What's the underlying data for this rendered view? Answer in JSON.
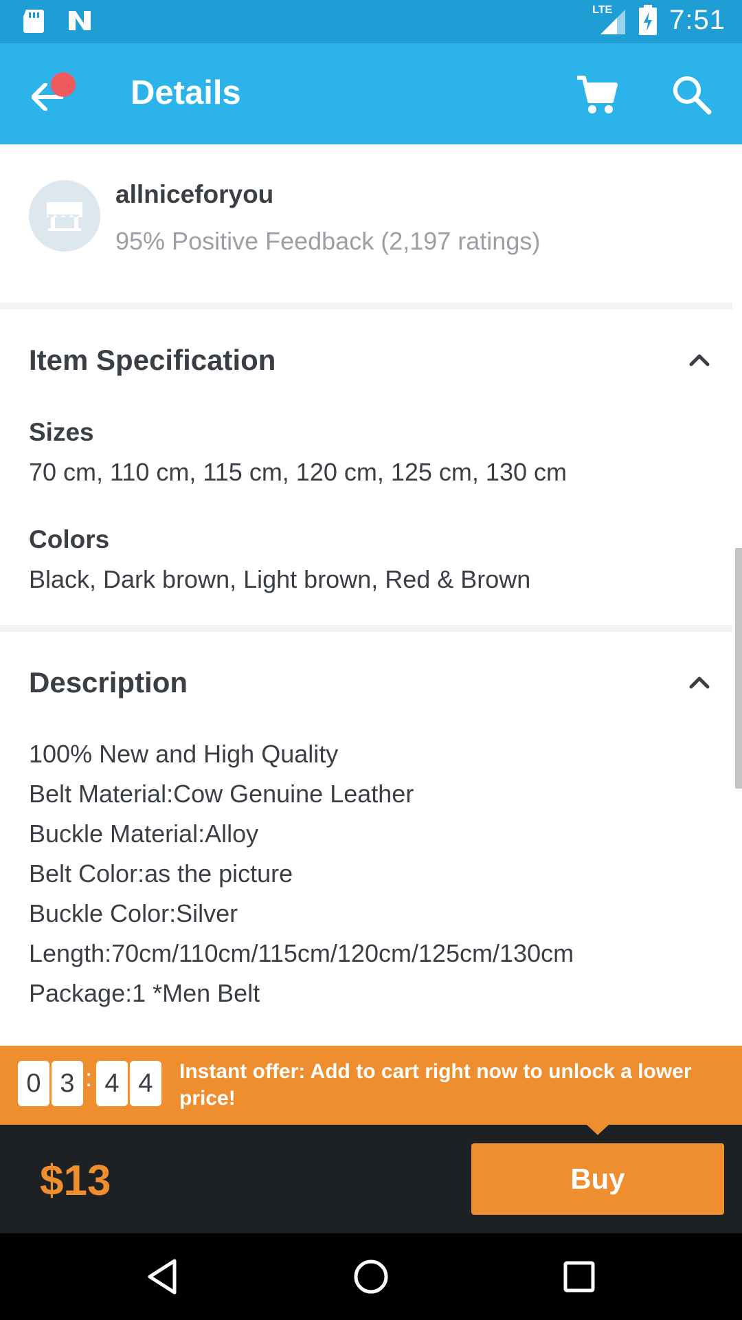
{
  "status_bar": {
    "network": "LTE",
    "time": "7:51",
    "icons": [
      "sd-card-icon",
      "n-app-icon",
      "lte-signal-icon",
      "battery-charging-icon"
    ]
  },
  "app_bar": {
    "title": "Details",
    "icons": [
      "back-arrow-icon",
      "cart-icon",
      "search-icon"
    ],
    "notification_dot_color": "#ee5a5e"
  },
  "seller": {
    "name": "allniceforyou",
    "feedback": "95% Positive Feedback (2,197 ratings)",
    "avatar_icon": "store-icon"
  },
  "item_specification": {
    "title": "Item Specification",
    "attributes": [
      {
        "label": "Sizes",
        "value": "70 cm, 110 cm, 115 cm, 120 cm, 125 cm, 130 cm"
      },
      {
        "label": "Colors",
        "value": "Black, Dark brown, Light brown, Red & Brown"
      }
    ]
  },
  "description": {
    "title": "Description",
    "lines": [
      "100% New and High Quality",
      "Belt Material:Cow Genuine Leather",
      "Buckle Material:Alloy",
      "Belt Color:as the picture",
      "Buckle Color:Silver",
      "Length:70cm/110cm/115cm/120cm/125cm/130cm",
      "Package:1 *Men Belt"
    ]
  },
  "offer": {
    "timer_digits": [
      "0",
      "3",
      "4",
      "4"
    ],
    "separator": ":",
    "text": "Instant offer: Add to cart right now to unlock a lower price!"
  },
  "purchase": {
    "price": "$13",
    "buy_label": "Buy"
  },
  "nav_bar": {
    "icons": [
      "back-triangle-icon",
      "home-circle-icon",
      "recents-square-icon"
    ]
  },
  "colors": {
    "status_bar": "#1f9ed6",
    "app_bar": "#2bb3ea",
    "accent_orange": "#ef8e2f",
    "dark_bar": "#1e2124",
    "text_dark": "#3a3f45",
    "text_muted": "#9aa0a6"
  }
}
